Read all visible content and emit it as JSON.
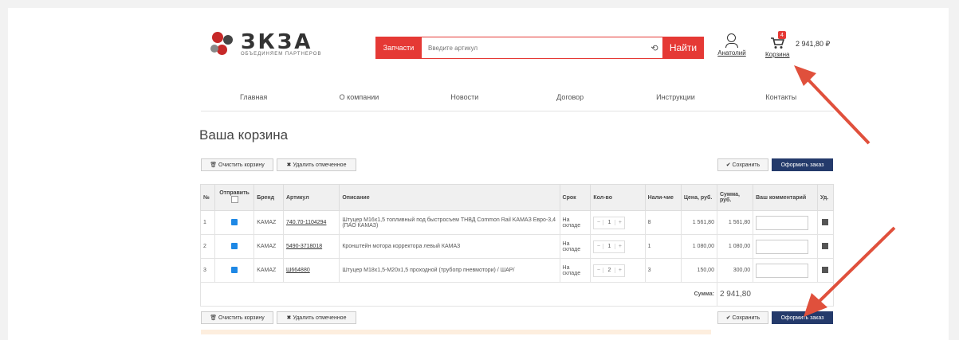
{
  "logo": {
    "name": "ЗКЗА",
    "subtitle": "объединяем партнеров"
  },
  "search": {
    "category": "Запчасти",
    "placeholder": "Введите артикул",
    "clear_glyph": "⟲",
    "button": "Найти"
  },
  "user": {
    "name": "Анатолий"
  },
  "cart": {
    "badge": "4",
    "total": "2 941,80 ₽",
    "link": "Корзина"
  },
  "nav": [
    "Главная",
    "О компании",
    "Новости",
    "Договор",
    "Инструкции",
    "Контакты"
  ],
  "page_title": "Ваша корзина",
  "actions": {
    "clear": "🗑 Очистить корзину",
    "delete_selected": "✖ Удалить отмеченное",
    "save": "✔ Сохранить",
    "checkout": "Оформить заказ"
  },
  "table": {
    "headers": {
      "num": "№",
      "mark": "Отправить",
      "brand": "Бренд",
      "article": "Артикул",
      "desc": "Описание",
      "term": "Срок",
      "qty": "Кол-во",
      "avail": "Нали-чие",
      "price": "Цена, руб.",
      "sum": "Сумма, руб.",
      "comment": "Ваш комментарий",
      "del": "Уд."
    },
    "rows": [
      {
        "num": "1",
        "brand": "KAMAZ",
        "article": "740.70-1104294",
        "desc": "Штуцер М16х1,5 топливный под быстросъем ТНВД Common Rail KAMAЗ Евро-3,4 (ПАО КАМАЗ)",
        "term": "На складе",
        "qty": "1",
        "avail": "8",
        "price": "1 561,80",
        "sum": "1 561,80"
      },
      {
        "num": "2",
        "brand": "KAMAZ",
        "article": "5490-3718018",
        "desc": "Кронштейн мотора корректора левый КАМАЗ",
        "term": "На складе",
        "qty": "1",
        "avail": "1",
        "price": "1 080,00",
        "sum": "1 080,00"
      },
      {
        "num": "3",
        "brand": "KAMAZ",
        "article": "Ш664880",
        "desc": "Штуцер М18х1,5-М20х1,5 проходной (трубопр пневмотори) / ШАР/",
        "term": "На складе",
        "qty": "2",
        "avail": "3",
        "price": "150,00",
        "sum": "300,00"
      }
    ],
    "total_label": "Сумма:",
    "total_value": "2 941,80"
  },
  "colors": {
    "accent": "#e53935",
    "primary": "#243a6b"
  }
}
